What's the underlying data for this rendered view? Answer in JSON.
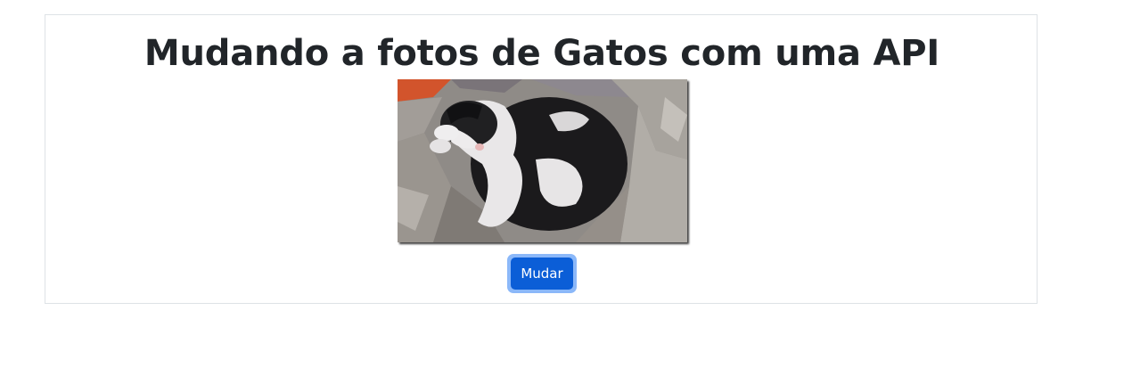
{
  "page": {
    "title": "Mudando a fotos de Gatos com uma API"
  },
  "image": {
    "alt": "Gato preto e branco dormindo enrolado em um cobertor cinza"
  },
  "button": {
    "label": "Mudar"
  },
  "colors": {
    "primary": "#0b5ed7",
    "focus_ring": "#8bb8f9",
    "border": "#dee2e6",
    "text": "#212529"
  }
}
